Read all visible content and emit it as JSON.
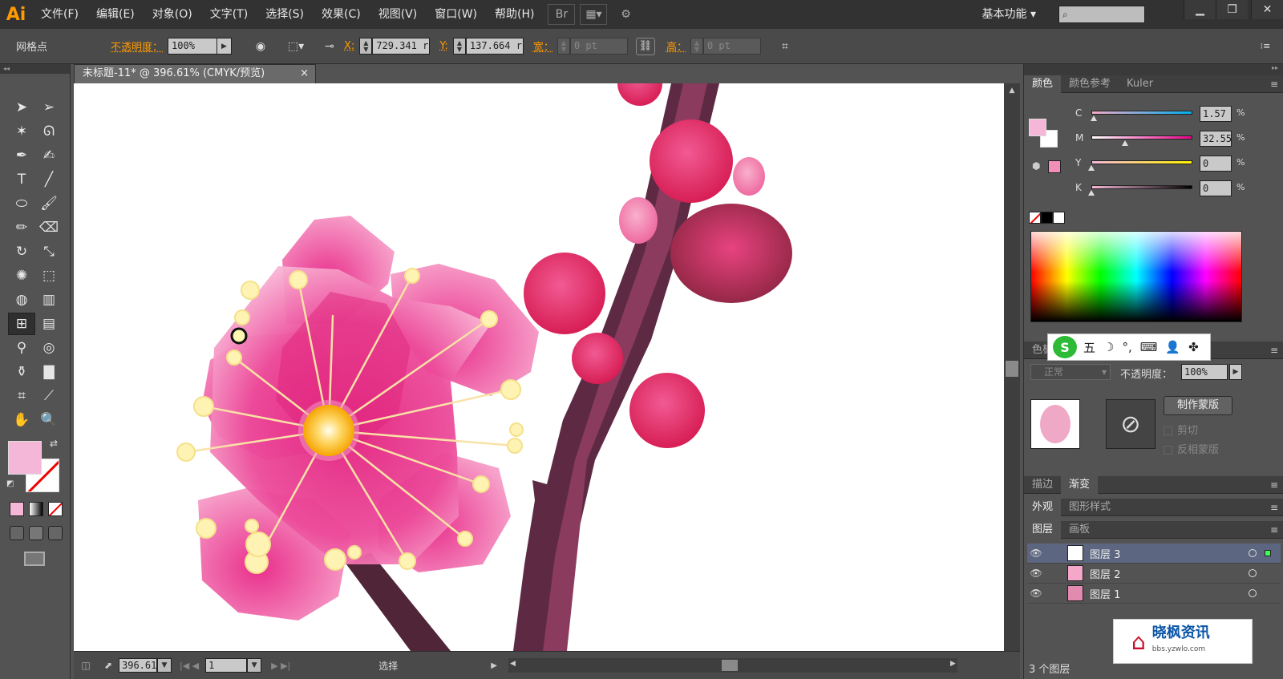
{
  "app": {
    "logo": "Ai"
  },
  "menu": [
    "文件(F)",
    "编辑(E)",
    "对象(O)",
    "文字(T)",
    "选择(S)",
    "效果(C)",
    "视图(V)",
    "窗口(W)",
    "帮助(H)"
  ],
  "menu_icons": [
    "bridge-icon",
    "arrange-documents-icon",
    "gpu-performance-icon"
  ],
  "workspace": {
    "label": "基本功能",
    "search_placeholder": ""
  },
  "window_controls": [
    "minimize-icon",
    "restore-icon",
    "close-icon"
  ],
  "control_bar": {
    "selection_label": "网格点",
    "opacity_label": "不透明度：",
    "opacity_value": "100%",
    "x_label": "X:",
    "x_value": "729.341 r",
    "y_label": "Y:",
    "y_value": "137.664 r",
    "w_label": "宽：",
    "w_value": "0 pt",
    "h_label": "高：",
    "h_value": "0 pt"
  },
  "document": {
    "tab_title": "未标题-11* @ 396.61% (CMYK/预览)",
    "zoom": "396.61",
    "artboard": "1",
    "status_tool": "选择"
  },
  "tools": [
    [
      "selection-tool-icon",
      "direct-selection-tool-icon"
    ],
    [
      "magic-wand-tool-icon",
      "lasso-tool-icon"
    ],
    [
      "pen-tool-icon",
      "curvature-pen-tool-icon"
    ],
    [
      "type-tool-icon",
      "line-segment-tool-icon"
    ],
    [
      "ellipse-tool-icon",
      "paintbrush-tool-icon"
    ],
    [
      "pencil-tool-icon",
      "eraser-tool-icon"
    ],
    [
      "rotate-tool-icon",
      "scale-tool-icon"
    ],
    [
      "warp-tool-icon",
      "free-transform-tool-icon"
    ],
    [
      "shape-builder-tool-icon",
      "graph-tool-icon"
    ],
    [
      "mesh-tool-icon",
      "gradient-tool-icon"
    ],
    [
      "eyedropper-tool-icon",
      "blend-tool-icon"
    ],
    [
      "symbol-sprayer-tool-icon",
      "column-graph-tool-icon"
    ],
    [
      "artboard-tool-icon",
      "slice-tool-icon"
    ],
    [
      "hand-tool-icon",
      "zoom-tool-icon"
    ]
  ],
  "colors": {
    "fill": "#f5b7d7",
    "accent": "#ff9a00",
    "selected_layer": "#5c6680"
  },
  "color_panel": {
    "tabs": [
      "颜色",
      "颜色参考",
      "Kuler"
    ],
    "channels": [
      {
        "label": "C",
        "value": "1.57",
        "level": 0.02,
        "gradient": "linear-gradient(to right,#f5a9c9,#00aeef)"
      },
      {
        "label": "M",
        "value": "32.55",
        "level": 0.33,
        "gradient": "linear-gradient(to right,#fff,#ec008c)"
      },
      {
        "label": "Y",
        "value": "0",
        "level": 0.0,
        "gradient": "linear-gradient(to right,#f5b7d7,#fff200)"
      },
      {
        "label": "K",
        "value": "0",
        "level": 0.0,
        "gradient": "linear-gradient(to right,#f5b7d7,#000)"
      }
    ],
    "unit": "%"
  },
  "transparency_panel": {
    "tab": "色板",
    "blend_mode": "正常",
    "opacity_label": "不透明度：",
    "opacity_value": "100%",
    "make_mask": "制作蒙版",
    "clip": "剪切",
    "invert_mask": "反相蒙版"
  },
  "stroke_gradient_tabs": [
    "描边",
    "渐变"
  ],
  "appearance_tabs": [
    "外观",
    "图形样式"
  ],
  "layers_panel": {
    "tabs": [
      "图层",
      "画板"
    ],
    "layers": [
      {
        "name": "图层 3",
        "selected": true
      },
      {
        "name": "图层 2",
        "selected": false
      },
      {
        "name": "图层 1",
        "selected": false
      }
    ],
    "count": "3 个图层"
  },
  "ime": {
    "logo": "S",
    "items": [
      "五",
      "☽",
      "°,",
      "⌨",
      "👤",
      "✤"
    ]
  },
  "watermark": {
    "name": "晓枫资讯",
    "url": "bbs.yzwlo.com"
  }
}
